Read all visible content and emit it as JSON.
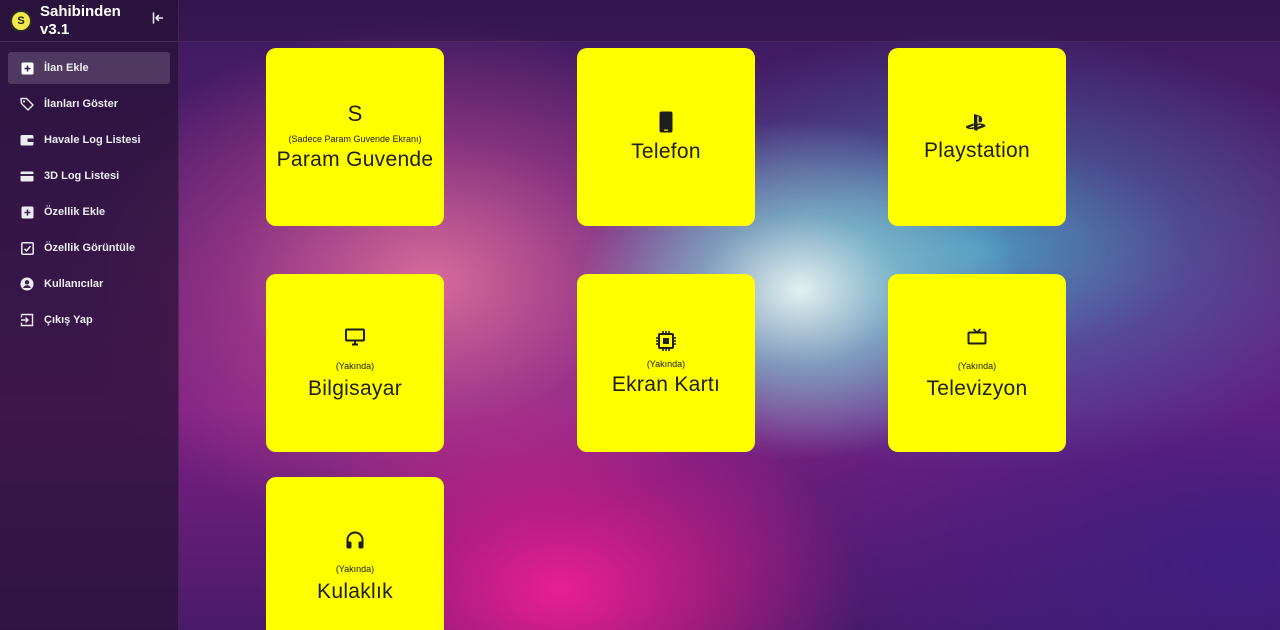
{
  "app": {
    "brand_logo_letter": "S",
    "title": "Sahibinden v3.1"
  },
  "sidebar": {
    "items": [
      {
        "label": "İlan Ekle",
        "icon": "add-box-icon",
        "active": true
      },
      {
        "label": "İlanları Göster",
        "icon": "tag-icon",
        "active": false
      },
      {
        "label": "Havale Log Listesi",
        "icon": "wallet-icon",
        "active": false
      },
      {
        "label": "3D Log Listesi",
        "icon": "credit-card-icon",
        "active": false
      },
      {
        "label": "Özellik Ekle",
        "icon": "add-box-icon",
        "active": false
      },
      {
        "label": "Özellik Görüntüle",
        "icon": "checkbox-icon",
        "active": false
      },
      {
        "label": "Kullanıcılar",
        "icon": "user-circle-icon",
        "active": false
      },
      {
        "label": "Çıkış Yap",
        "icon": "logout-icon",
        "active": false
      }
    ]
  },
  "cards": [
    {
      "glyph": "S",
      "subtitle": "(Sadece Param Guvende Ekranı)",
      "title": "Param Guvende",
      "icon": "letter-s-icon"
    },
    {
      "subtitle": "",
      "title": "Telefon",
      "icon": "smartphone-icon"
    },
    {
      "subtitle": "",
      "title": "Playstation",
      "icon": "playstation-icon"
    },
    {
      "subtitle": "(Yakında)",
      "title": "Bilgisayar",
      "icon": "monitor-icon"
    },
    {
      "subtitle": "(Yakında)",
      "title": "Ekran Kartı",
      "icon": "chip-icon"
    },
    {
      "subtitle": "(Yakında)",
      "title": "Televizyon",
      "icon": "tv-icon"
    },
    {
      "subtitle": "(Yakında)",
      "title": "Kulaklık",
      "icon": "headphones-icon"
    }
  ],
  "colors": {
    "card_bg": "#ffff00",
    "sidebar_bg": "#26123a",
    "text_light": "#ececf2"
  }
}
